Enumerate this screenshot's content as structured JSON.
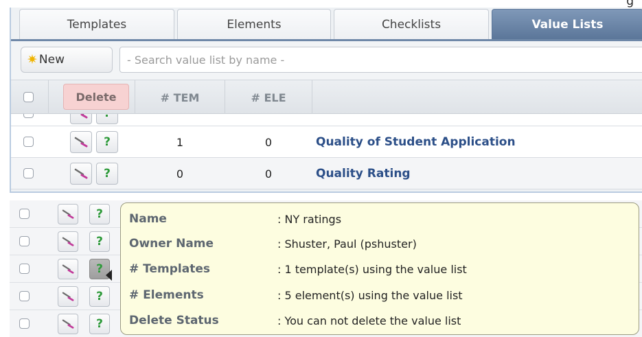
{
  "corner_text": "g",
  "tabs": [
    {
      "label": "Templates",
      "active": false
    },
    {
      "label": "Elements",
      "active": false
    },
    {
      "label": "Checklists",
      "active": false
    },
    {
      "label": "Value Lists",
      "active": true
    }
  ],
  "toolbar": {
    "new_label": "New",
    "search_placeholder": "- Search value list by name -"
  },
  "table_header": {
    "delete_label": "Delete",
    "col_templates": "# TEM",
    "col_elements": "# ELE"
  },
  "rows": [
    {
      "templates": "1",
      "elements": "0",
      "name": "Quality of Student Application"
    },
    {
      "templates": "0",
      "elements": "0",
      "name": "Quality Rating"
    }
  ],
  "tooltip": {
    "rows": [
      {
        "label": "Name",
        "value": ": NY ratings"
      },
      {
        "label": "Owner Name",
        "value": ": Shuster, Paul (pshuster)"
      },
      {
        "label": "# Templates",
        "value": ": 1 template(s) using the value list"
      },
      {
        "label": "# Elements",
        "value": ": 5 element(s) using the value list"
      },
      {
        "label": "Delete Status",
        "value": ": You can not delete the value list"
      }
    ]
  },
  "icons": {
    "edit": "wand-edit-icon",
    "info": "question-mark-icon",
    "new": "star-icon"
  },
  "colors": {
    "active_tab": "#6f88a8",
    "delete_bg": "#f7d2d2",
    "link": "#2c4f88",
    "tooltip_bg": "#fdfde0",
    "qmark": "#2e9a3a"
  }
}
